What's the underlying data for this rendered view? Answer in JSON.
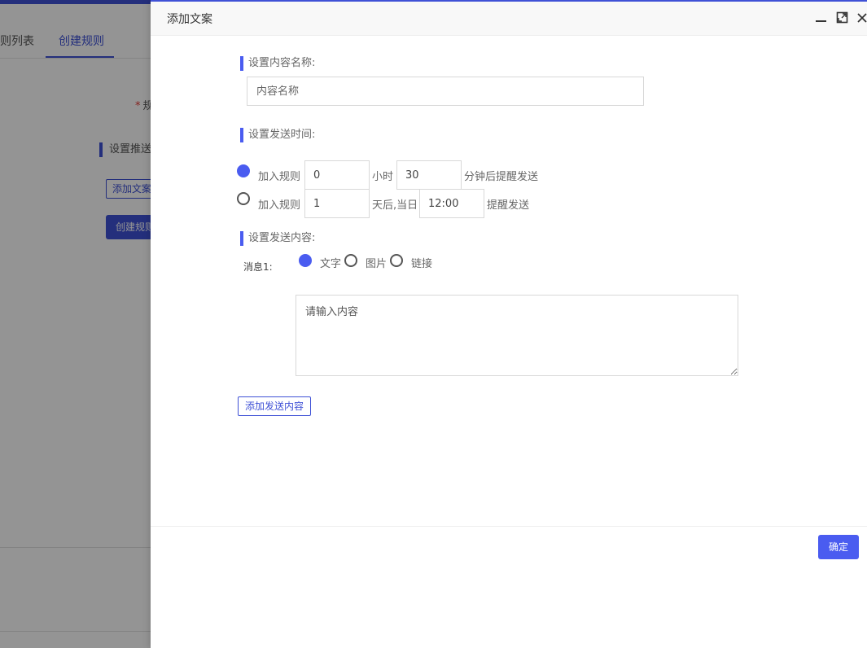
{
  "background": {
    "tabs": [
      {
        "label": "规则列表",
        "active": false
      },
      {
        "label": "创建规则",
        "active": true
      }
    ],
    "field_label": "规",
    "section_label": "设置推送",
    "add_copy_button": "添加文案",
    "create_rule_button": "创建规则"
  },
  "modal": {
    "title": "添加文案",
    "header_icons": [
      "minimize-icon",
      "maximize-icon",
      "close-icon"
    ],
    "name_section": {
      "label": "设置内容名称:",
      "placeholder": "内容名称"
    },
    "time_section": {
      "label": "设置发送时间:",
      "option1": {
        "selected": true,
        "prefix": "加入规则",
        "hours_value": "0",
        "hours_unit": "小时",
        "minutes_value": "30",
        "suffix": "分钟后提醒发送"
      },
      "option2": {
        "selected": false,
        "prefix": "加入规则",
        "days_value": "1",
        "days_unit": "天后,当日",
        "time_value": "12:00",
        "suffix": "提醒发送"
      }
    },
    "content_section": {
      "label": "设置发送内容:",
      "message_label": "消息1:",
      "types": [
        {
          "label": "文字",
          "selected": true
        },
        {
          "label": "图片",
          "selected": false
        },
        {
          "label": "链接",
          "selected": false
        }
      ],
      "textarea_placeholder": "请输入内容",
      "add_button": "添加发送内容"
    },
    "confirm_button": "确定"
  },
  "colors": {
    "accent": "#4a5cf0",
    "brand": "#3f51d6",
    "overlay": "rgba(0,0,0,0.42)"
  }
}
